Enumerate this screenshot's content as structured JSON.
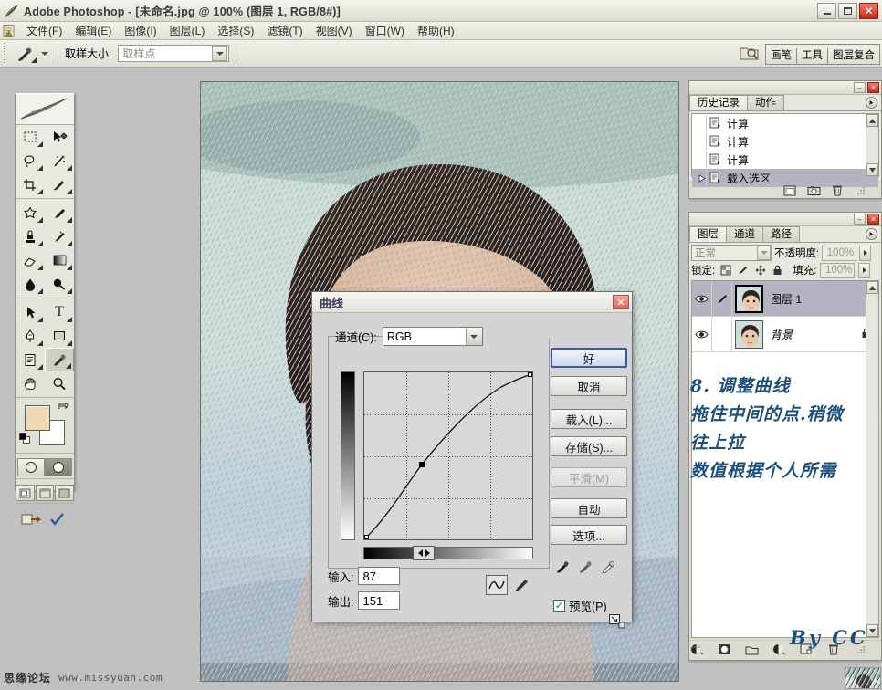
{
  "window": {
    "title": "Adobe Photoshop - [未命名.jpg @ 100% (图层 1, RGB/8#)]",
    "app_icon": "photoshop-feather-icon",
    "buttons": {
      "minimize": "minimize-icon",
      "maximize": "maximize-icon",
      "close": "✕"
    }
  },
  "menubar": {
    "doc_icon": "document-icon",
    "items": [
      {
        "label": "文件(F)"
      },
      {
        "label": "编辑(E)"
      },
      {
        "label": "图像(I)"
      },
      {
        "label": "图层(L)"
      },
      {
        "label": "选择(S)"
      },
      {
        "label": "滤镜(T)"
      },
      {
        "label": "视图(V)"
      },
      {
        "label": "窗口(W)"
      },
      {
        "label": "帮助(H)"
      }
    ]
  },
  "options_bar": {
    "tool_icon": "eyedropper-icon",
    "sample_size_label": "取样大小:",
    "sample_size_value": "取样点",
    "palette_well": {
      "folder_icon": "file-browser-icon",
      "tabs": [
        "画笔",
        "工具",
        "图层复合"
      ]
    }
  },
  "toolbox": {
    "header_icon": "photoshop-feather-logo",
    "tools": [
      {
        "name": "marquee-tool",
        "glyph": "▭"
      },
      {
        "name": "move-tool",
        "glyph": "✥"
      },
      {
        "name": "lasso-tool",
        "glyph": "◠"
      },
      {
        "name": "magic-wand-tool",
        "glyph": "✦"
      },
      {
        "name": "crop-tool",
        "glyph": "⌗"
      },
      {
        "name": "slice-tool",
        "glyph": "✂"
      },
      {
        "name": "healing-brush-tool",
        "glyph": "❇"
      },
      {
        "name": "brush-tool",
        "glyph": "✎"
      },
      {
        "name": "clone-stamp-tool",
        "glyph": "⚑"
      },
      {
        "name": "history-brush-tool",
        "glyph": "✐"
      },
      {
        "name": "eraser-tool",
        "glyph": "▱"
      },
      {
        "name": "gradient-tool",
        "glyph": "▤"
      },
      {
        "name": "blur-tool",
        "glyph": "💧"
      },
      {
        "name": "dodge-tool",
        "glyph": "●"
      },
      {
        "name": "path-selection-tool",
        "glyph": "➤"
      },
      {
        "name": "type-tool",
        "glyph": "T"
      },
      {
        "name": "pen-tool",
        "glyph": "✒"
      },
      {
        "name": "shape-tool",
        "glyph": "▬"
      },
      {
        "name": "notes-tool",
        "glyph": "▤"
      },
      {
        "name": "eyedropper-tool",
        "glyph": "⟋"
      },
      {
        "name": "hand-tool",
        "glyph": "✋"
      },
      {
        "name": "zoom-tool",
        "glyph": "🔍"
      }
    ],
    "colors": {
      "foreground": "#f0d8b5",
      "background": "#ffffff",
      "swap_icon": "swap-colors-icon",
      "default_icon": "default-colors-icon"
    },
    "quick_mask": [
      "standard-mode",
      "quick-mask-mode"
    ],
    "screen_modes": [
      "standard-screen-mode",
      "full-screen-menubar-mode",
      "full-screen-mode"
    ],
    "jump_to": [
      "jump-to-imageready-icon",
      "edit-in-imageready-icon"
    ]
  },
  "history_palette": {
    "tabs": [
      "历史记录",
      "动作"
    ],
    "active_tab": "历史记录",
    "menu_icon": "palette-menu-icon",
    "items": [
      {
        "label": "计算",
        "selected": false
      },
      {
        "label": "计算",
        "selected": false
      },
      {
        "label": "计算",
        "selected": false
      },
      {
        "label": "载入选区",
        "selected": true
      }
    ],
    "footer_icons": [
      "new-document-from-state-icon",
      "new-snapshot-icon",
      "delete-state-icon"
    ]
  },
  "layers_palette": {
    "tabs": [
      "图层",
      "通道",
      "路径"
    ],
    "active_tab": "图层",
    "menu_icon": "palette-menu-icon",
    "blend_mode": "正常",
    "opacity_label": "不透明度:",
    "opacity_value": "100%",
    "lock_label": "锁定:",
    "lock_icons": [
      "lock-transparency-icon",
      "lock-image-icon",
      "lock-position-icon",
      "lock-all-icon"
    ],
    "fill_label": "填充:",
    "fill_value": "100%",
    "layers": [
      {
        "name": "图层 1",
        "selected": true,
        "visible": true,
        "locked": false,
        "italic": false
      },
      {
        "name": "背景",
        "selected": false,
        "visible": true,
        "locked": true,
        "italic": true
      }
    ],
    "footer_icons": [
      "layer-style-icon",
      "layer-mask-icon",
      "new-group-icon",
      "new-adjustment-layer-icon",
      "new-layer-icon",
      "delete-layer-icon"
    ]
  },
  "dialog": {
    "title": "曲线",
    "close_glyph": "✕",
    "channel_label": "通道(C):",
    "channel_value": "RGB",
    "buttons": [
      {
        "label": "好",
        "name": "ok-button",
        "style": "default",
        "disabled": false
      },
      {
        "label": "取消",
        "name": "cancel-button",
        "style": "normal",
        "disabled": false
      },
      {
        "label": "载入(L)...",
        "name": "load-button",
        "style": "normal",
        "disabled": false
      },
      {
        "label": "存储(S)...",
        "name": "save-button",
        "style": "normal",
        "disabled": false
      },
      {
        "label": "平滑(M)",
        "name": "smooth-button",
        "style": "normal",
        "disabled": true
      },
      {
        "label": "自动",
        "name": "auto-button",
        "style": "normal",
        "disabled": false
      },
      {
        "label": "选项...",
        "name": "options-button",
        "style": "normal",
        "disabled": false
      }
    ],
    "input_label": "输入:",
    "input_value": "87",
    "output_label": "输出:",
    "output_value": "151",
    "curve_tool_icon": "curve-draw-icon",
    "pencil_tool_icon": "pencil-draw-icon",
    "eyedroppers": [
      "set-black-point-icon",
      "set-gray-point-icon",
      "set-white-point-icon"
    ],
    "preview_label": "预览(P)",
    "preview_checked": true,
    "resize_icon": "grid-size-toggle-icon"
  },
  "annotation": {
    "lines": [
      "8. 调整曲线",
      "拖住中间的点.稍微",
      "往上拉",
      "数值根据个人所需"
    ],
    "signature": "By  CC",
    "color": "#1f4e79"
  },
  "watermark": {
    "site_cn": "思缘论坛",
    "site_url": "www.missyuan.com"
  },
  "chart_data": {
    "type": "line",
    "title": "曲线 (Curves) — RGB",
    "xlabel": "输入",
    "ylabel": "输出",
    "xlim": [
      0,
      255
    ],
    "ylim": [
      0,
      255
    ],
    "grid": true,
    "control_points": [
      {
        "input": 0,
        "output": 0
      },
      {
        "input": 87,
        "output": 151
      },
      {
        "input": 255,
        "output": 255
      }
    ],
    "selected_point": {
      "input": 87,
      "output": 151
    }
  }
}
